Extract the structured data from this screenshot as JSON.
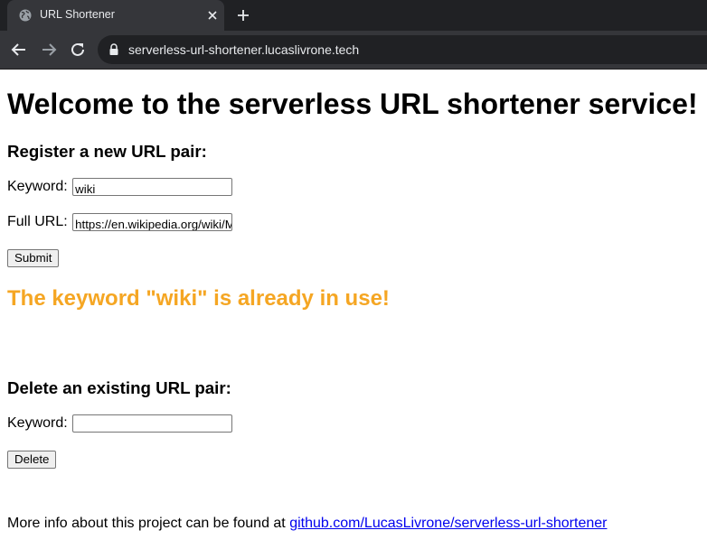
{
  "browser": {
    "tab_title": "URL Shortener",
    "url": "serverless-url-shortener.lucaslivrone.tech"
  },
  "page": {
    "heading": "Welcome to the serverless URL shortener service!",
    "register": {
      "heading": "Register a new URL pair:",
      "keyword_label": "Keyword:",
      "keyword_value": "wiki",
      "url_label": "Full URL:",
      "url_value": "https://en.wikipedia.org/wiki/M",
      "submit_label": "Submit"
    },
    "error_message": "The keyword \"wiki\" is already in use!",
    "delete": {
      "heading": "Delete an existing URL pair:",
      "keyword_label": "Keyword:",
      "keyword_value": "",
      "delete_label": "Delete"
    },
    "footer": {
      "text": "More info about this project can be found at ",
      "link_text": "github.com/LucasLivrone/serverless-url-shortener"
    }
  },
  "colors": {
    "error": "#f5a623",
    "link": "#0000ee"
  }
}
